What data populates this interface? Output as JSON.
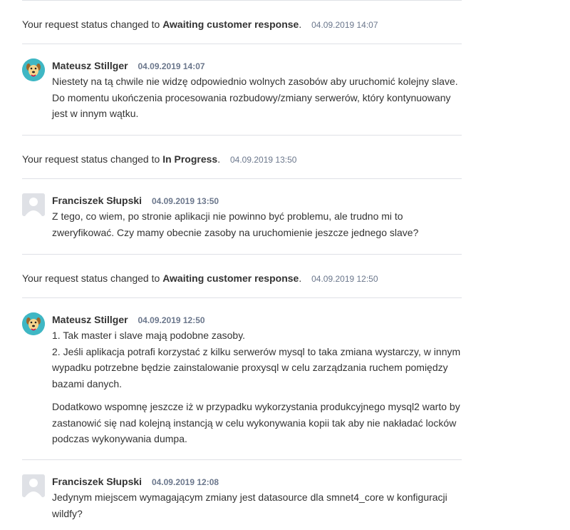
{
  "activity": [
    {
      "kind": "status",
      "prefix": "Your request status changed to",
      "status": "Awaiting customer response",
      "time": "04.09.2019 14:07"
    },
    {
      "kind": "comment",
      "author": "Mateusz Stillger",
      "time": "04.09.2019 14:07",
      "avatar": "dog-avatar",
      "paragraphs": [
        "Niestety na tą chwile nie widzę odpowiednio wolnych zasobów aby uruchomić kolejny slave. Do momentu ukończenia procesowania rozbudowy/zmiany serwerów, który kontynuowany jest w innym wątku."
      ]
    },
    {
      "kind": "status",
      "prefix": "Your request status changed to",
      "status": "In Progress",
      "time": "04.09.2019 13:50"
    },
    {
      "kind": "comment",
      "author": "Franciszek Słupski",
      "time": "04.09.2019 13:50",
      "avatar": "default-avatar",
      "paragraphs": [
        "Z tego, co wiem, po stronie aplikacji nie powinno być problemu, ale trudno mi to zweryfikować. Czy mamy obecnie zasoby na uruchomienie jeszcze jednego slave?"
      ]
    },
    {
      "kind": "status",
      "prefix": "Your request status changed to",
      "status": "Awaiting customer response",
      "time": "04.09.2019 12:50"
    },
    {
      "kind": "comment",
      "author": "Mateusz Stillger",
      "time": "04.09.2019 12:50",
      "avatar": "dog-avatar",
      "paragraphs": [
        "1. Tak master i slave mają podobne zasoby.",
        "2. Jeśli aplikacja potrafi korzystać z kilku serwerów mysql to taka zmiana wystarczy, w innym wypadku potrzebne będzie zainstalowanie proxysql w celu zarządzania ruchem pomiędzy bazami danych.",
        "Dodatkowo wspomnę jeszcze iż w przypadku wykorzystania produkcyjnego mysql2 warto by zastanowić się nad kolejną instancją w celu wykonywania kopii tak aby nie nakładać locków podczas wykonywania dumpa."
      ]
    },
    {
      "kind": "comment",
      "author": "Franciszek Słupski",
      "time": "04.09.2019 12:08",
      "avatar": "default-avatar",
      "paragraphs": [
        "Jedynym miejscem wymagającym zmiany jest datasource dla smnet4_core w konfiguracji wildfy?"
      ]
    }
  ]
}
